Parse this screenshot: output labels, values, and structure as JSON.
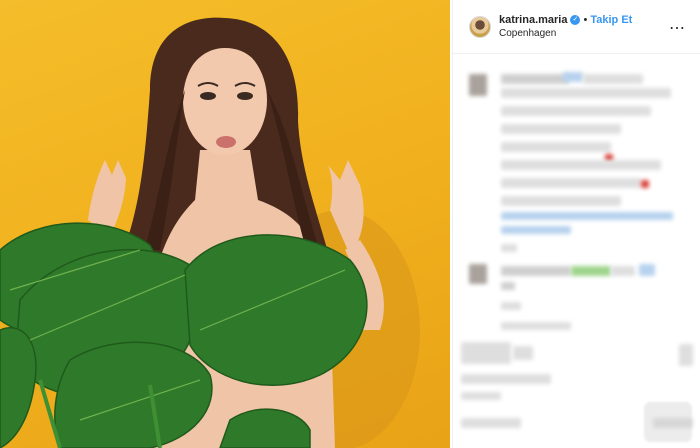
{
  "post": {
    "username": "katrina.maria",
    "separator": "•",
    "follow_label": "Takip Et",
    "location": "Copenhagen",
    "verified_icon": "verified-badge-icon",
    "more_icon": "more-options-icon"
  },
  "colors": {
    "photo_background": "#f2b21f",
    "leaf": "#2f7a2a",
    "link_blue": "#3897f0"
  }
}
